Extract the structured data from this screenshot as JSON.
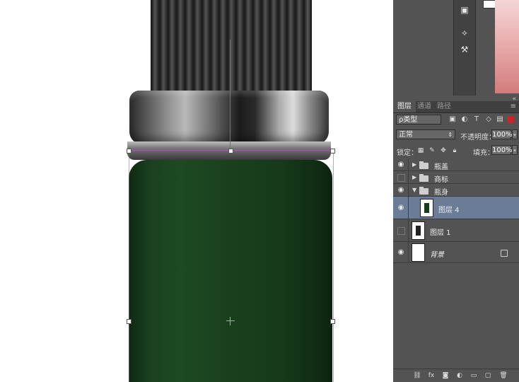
{
  "panel": {
    "tabs": [
      "图层",
      "通道",
      "路径"
    ],
    "filter_label": "ρ类型",
    "blend_mode": "正常",
    "opacity_label": "不透明度：",
    "opacity_value": "100%",
    "lock_label": "锁定：",
    "fill_label": "填充：",
    "fill_value": "100%",
    "collapse_icon": "«"
  },
  "layers": [
    {
      "name": "瓶盖",
      "type": "group",
      "visible": true,
      "expanded": false
    },
    {
      "name": "商标",
      "type": "group",
      "visible": false,
      "expanded": false
    },
    {
      "name": "瓶身",
      "type": "group",
      "visible": true,
      "expanded": true
    },
    {
      "name": "图层 4",
      "type": "layer",
      "visible": true,
      "selected": true
    },
    {
      "name": "图层 1",
      "type": "layer",
      "visible": false
    },
    {
      "name": "背景",
      "type": "layer",
      "visible": true,
      "locked": true
    }
  ],
  "colors": {
    "bottle_green": "#19401d",
    "guide": "#c040d0",
    "selected_row": "#6b7c96",
    "panel_bg": "#535353"
  }
}
